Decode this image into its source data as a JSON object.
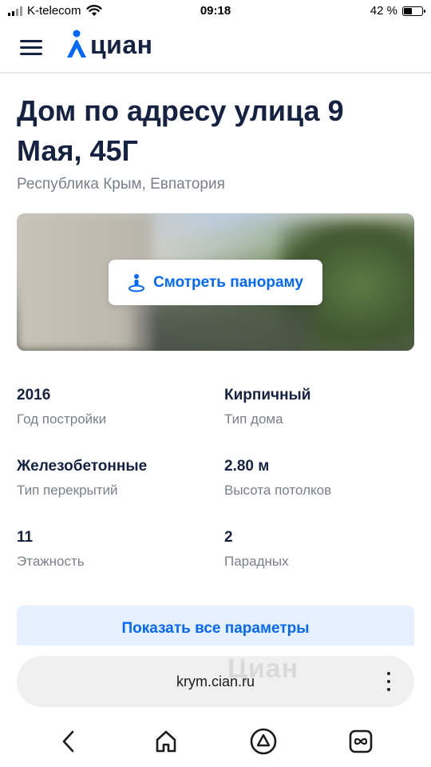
{
  "status_bar": {
    "carrier": "K-telecom",
    "time": "09:18",
    "battery_percent": "42 %",
    "battery_level": 0.42,
    "icons": [
      "signal-icon",
      "wifi-icon",
      "battery-icon"
    ]
  },
  "header": {
    "logo_text": "циан",
    "icons": [
      "menu-icon",
      "cian-logo-icon"
    ],
    "colors": {
      "logo_accent": "#0468ff",
      "text": "#152242"
    }
  },
  "page": {
    "title": "Дом по адресу улица 9 Мая, 45Г",
    "subtitle": "Республика Крым, Евпатория"
  },
  "panorama": {
    "button_label": "Смотреть панораму",
    "icon": "panorama-person-icon"
  },
  "params": [
    {
      "value": "2016",
      "label": "Год постройки"
    },
    {
      "value": "Кирпичный",
      "label": "Тип дома"
    },
    {
      "value": "Железобетонные",
      "label": "Тип перекрытий"
    },
    {
      "value": "2.80 м",
      "label": "Высота потолков"
    },
    {
      "value": "11",
      "label": "Этажность"
    },
    {
      "value": "2",
      "label": "Парадных"
    }
  ],
  "show_all_label": "Показать все параметры",
  "browser": {
    "url": "krym.cian.ru",
    "watermark": "Циан",
    "nav_icons": [
      "back-icon",
      "home-icon",
      "alice-icon",
      "tabs-icon"
    ]
  },
  "colors": {
    "accent": "#0468ff",
    "muted_text": "#7a7f8a",
    "button_bg": "#e6f0ff"
  }
}
